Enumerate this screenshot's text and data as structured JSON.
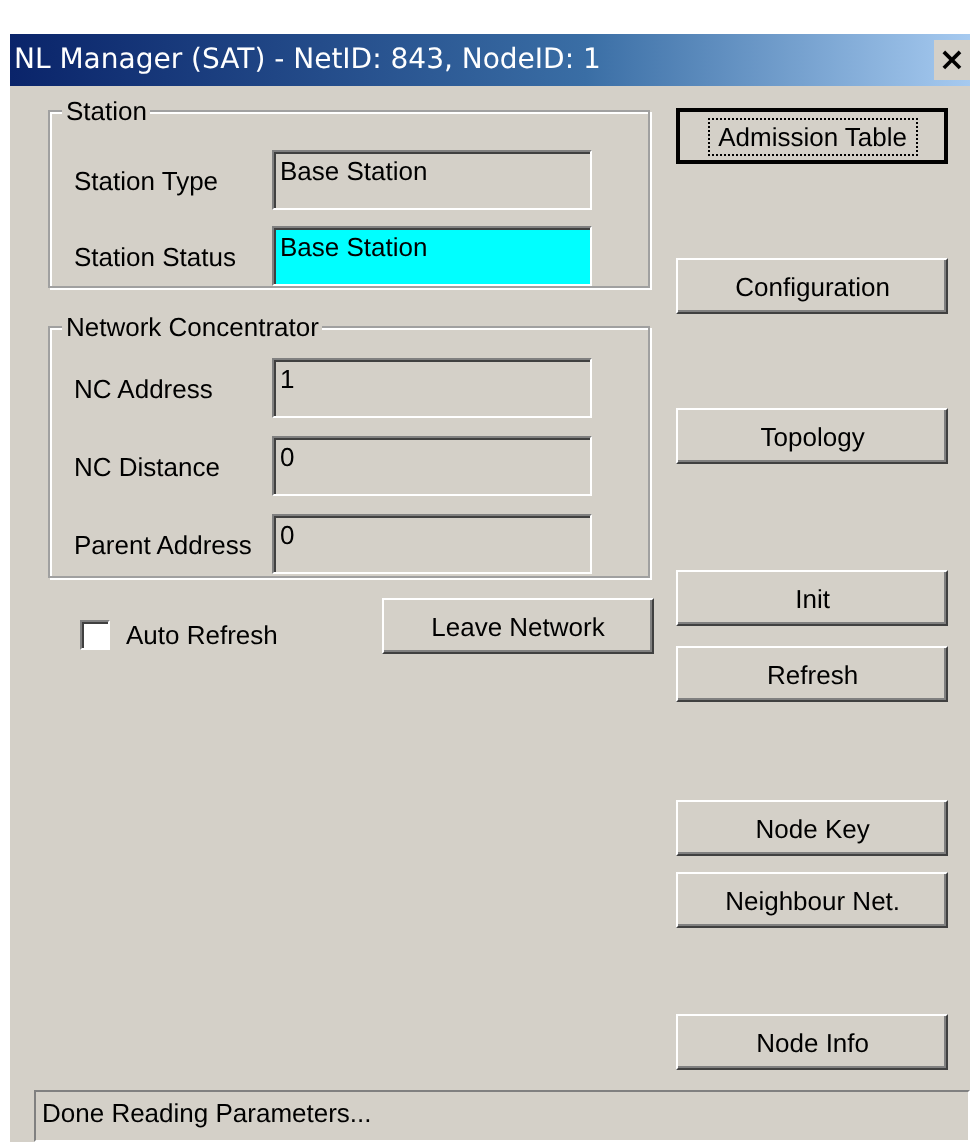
{
  "window": {
    "title": "NL Manager (SAT) - NetID: 843, NodeID: 1",
    "close": "×"
  },
  "groups": [
    {
      "title": "Station",
      "fields": [
        {
          "label": "Station Type",
          "value": "Base Station",
          "highlighted": false
        },
        {
          "label": "Station Status",
          "value": "Base Station",
          "highlighted": true
        }
      ]
    },
    {
      "title": "Network Concentrator",
      "fields": [
        {
          "label": "NC Address",
          "value": "1",
          "highlighted": false
        },
        {
          "label": "NC Distance",
          "value": "0",
          "highlighted": false
        },
        {
          "label": "Parent Address",
          "value": "0",
          "highlighted": false
        }
      ]
    }
  ],
  "auto_refresh": {
    "label": "Auto Refresh",
    "checked": false
  },
  "leave_button": {
    "label": "Leave Network",
    "focused": false
  },
  "side_buttons": [
    {
      "label": "Admission Table",
      "focused": true
    },
    {
      "label": "Configuration",
      "focused": false
    },
    {
      "label": "Topology",
      "focused": false
    },
    {
      "label": "Init",
      "focused": false
    },
    {
      "label": "Refresh",
      "focused": false
    },
    {
      "label": "Node Key",
      "focused": false
    },
    {
      "label": "Neighbour Net.",
      "focused": false
    },
    {
      "label": "Node Info",
      "focused": false
    }
  ],
  "status_bar": "Done Reading Parameters..."
}
